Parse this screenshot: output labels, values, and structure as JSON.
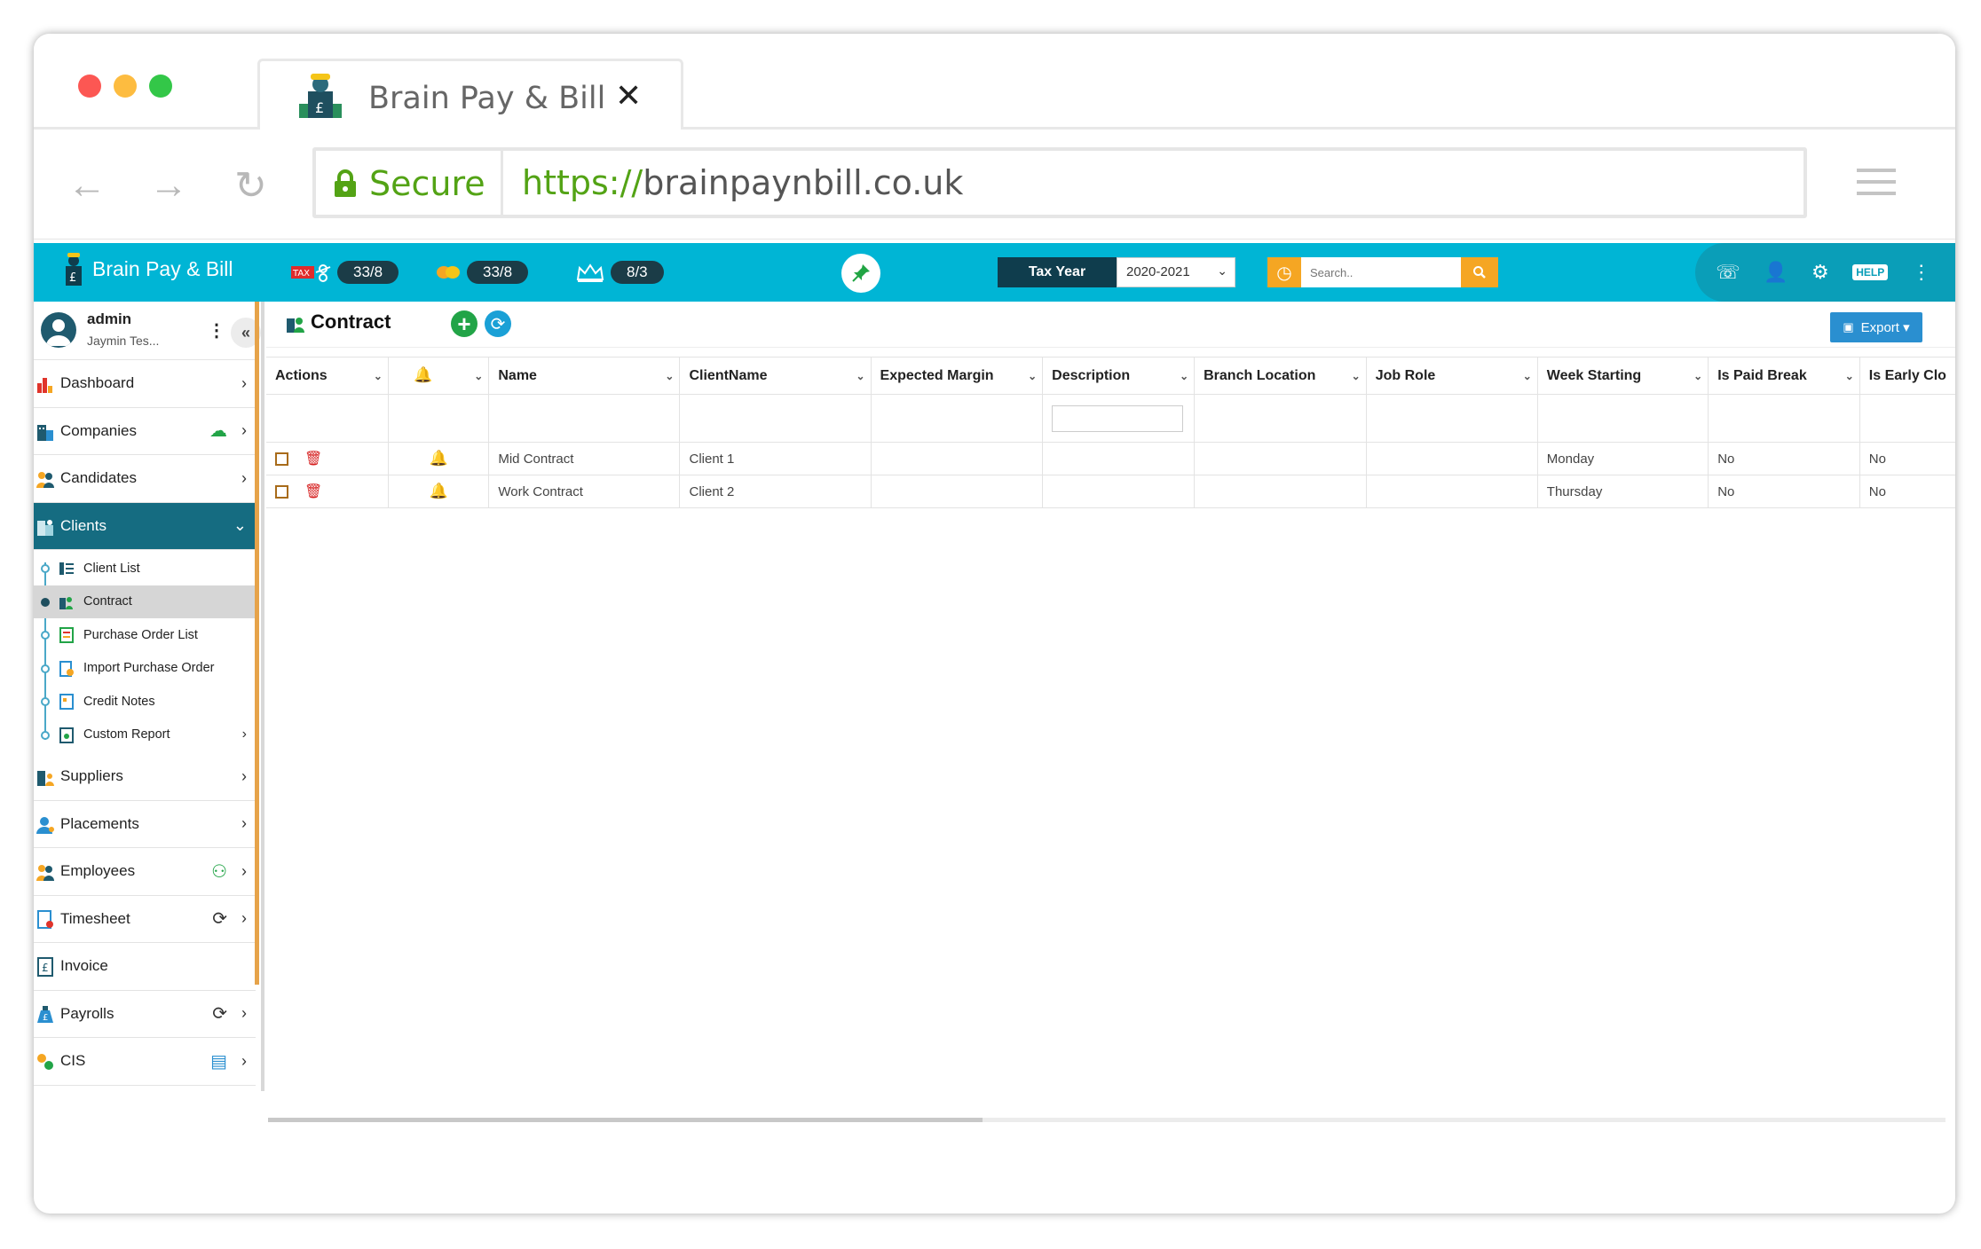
{
  "browser": {
    "tab_title": "Brain Pay & Bill",
    "tab_close": "✕",
    "back": "←",
    "forward": "→",
    "reload": "↻",
    "secure_label": "Secure",
    "url_protocol": "https://",
    "url_host": "brainpaynbill.co.uk",
    "dot_colors": [
      "#fc5753",
      "#fdbc40",
      "#33c748"
    ]
  },
  "header": {
    "brand": "Brain Pay & Bill",
    "tax_badge": "33/8",
    "coins_badge": "33/8",
    "crown_badge": "8/3",
    "tax_icon_label": "TAX",
    "tax_year_label": "Tax Year",
    "tax_year_value": "2020-2021",
    "search_placeholder": "Search..",
    "accent_color": "#00b5d5",
    "dark_color": "#0f3d4d",
    "orange_color": "#f5a623"
  },
  "user": {
    "name": "admin",
    "subtitle": "Jaymin Tes..."
  },
  "sidebar": {
    "items": [
      {
        "label": "Dashboard",
        "icon": "bar-chart-icon"
      },
      {
        "label": "Companies",
        "icon": "building-icon"
      },
      {
        "label": "Candidates",
        "icon": "users-icon"
      },
      {
        "label": "Clients",
        "icon": "office-icon"
      },
      {
        "label": "Suppliers",
        "icon": "supplier-icon"
      },
      {
        "label": "Placements",
        "icon": "person-pin-icon"
      },
      {
        "label": "Employees",
        "icon": "employees-icon"
      },
      {
        "label": "Timesheet",
        "icon": "timesheet-icon"
      },
      {
        "label": "Invoice",
        "icon": "invoice-icon"
      },
      {
        "label": "Payrolls",
        "icon": "money-bag-icon"
      },
      {
        "label": "CIS",
        "icon": "cis-icon"
      }
    ],
    "client_sub": [
      {
        "label": "Client List"
      },
      {
        "label": "Contract"
      },
      {
        "label": "Purchase Order List"
      },
      {
        "label": "Import Purchase Order"
      },
      {
        "label": "Credit Notes"
      },
      {
        "label": "Custom Report"
      }
    ]
  },
  "page": {
    "title": "Contract",
    "export_label": "Export ▾"
  },
  "table": {
    "columns": [
      "Actions",
      "",
      "Name",
      "ClientName",
      "Expected Margin",
      "Description",
      "Branch Location",
      "Job Role",
      "Week Starting",
      "Is Paid Break",
      "Is Early Clo"
    ],
    "rows": [
      {
        "name": "Mid Contract",
        "client": "Client 1",
        "expected_margin": "",
        "description": "",
        "branch": "",
        "job_role": "",
        "week_starting": "Monday",
        "is_paid_break": "No",
        "is_early": "No"
      },
      {
        "name": "Work Contract",
        "client": "Client 2",
        "expected_margin": "",
        "description": "",
        "branch": "",
        "job_role": "",
        "week_starting": "Thursday",
        "is_paid_break": "No",
        "is_early": "No"
      }
    ]
  }
}
